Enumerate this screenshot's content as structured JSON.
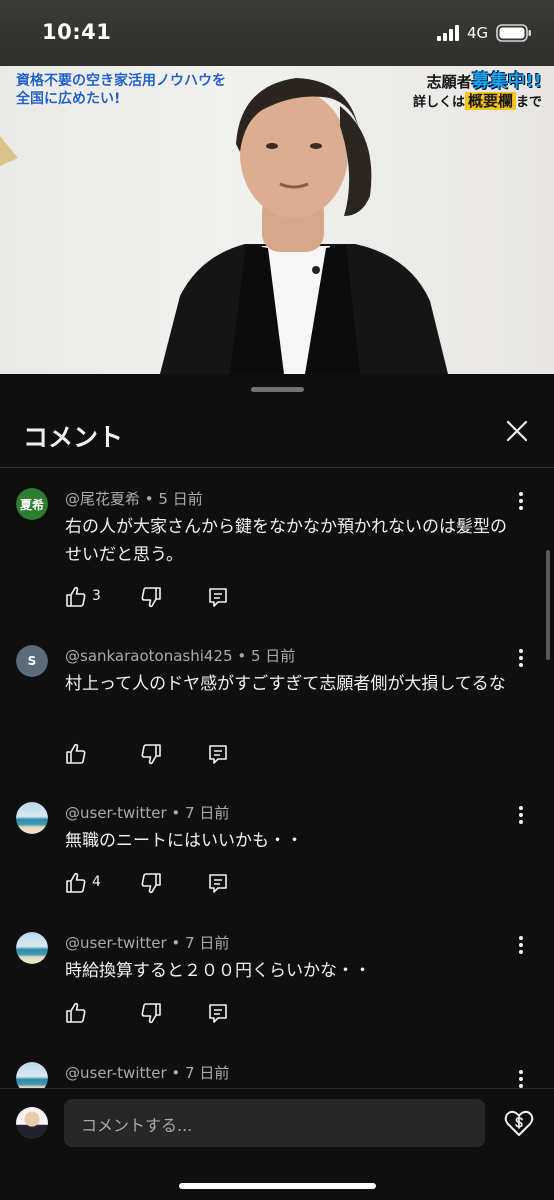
{
  "status_bar": {
    "time": "10:41",
    "network": "4G"
  },
  "video": {
    "overlay_left_line1": "資格不要の空き家活用ノウハウを",
    "overlay_left_line2": "全国に広めたい!",
    "overlay_right_prefix": "志願者",
    "overlay_right_highlight": "募集中!!",
    "overlay_right_line2_prefix": "詳しくは",
    "overlay_right_line2_highlight": "概要欄",
    "overlay_right_line2_suffix": "まで"
  },
  "sheet": {
    "title": "コメント"
  },
  "comments": [
    {
      "avatar_text": "夏希",
      "avatar_color": "#2f7d2f",
      "author": "@尾花夏希",
      "age": "5 日前",
      "text": "右の人が大家さんから鍵をなかなか預かれないのは髪型のせいだと思う。",
      "likes": "3"
    },
    {
      "avatar_text": "S",
      "avatar_color": "#5b6b7a",
      "author": "@sankaraotonashi425",
      "age": "5 日前",
      "text": "村上って人のドヤ感がすごすぎて志願者側が大損してるな",
      "likes": ""
    },
    {
      "avatar_text": "",
      "author": "@user-twitter",
      "age": "7 日前",
      "text": "無職のニートにはいいかも・・",
      "likes": "4"
    },
    {
      "avatar_text": "",
      "author": "@user-twitter",
      "age": "7 日前",
      "text": "時給換算すると２００円くらいかな・・",
      "likes": ""
    },
    {
      "avatar_text": "",
      "author": "@user-twitter",
      "age": "7 日前",
      "text": "",
      "likes": ""
    }
  ],
  "input": {
    "placeholder": "コメントする..."
  }
}
